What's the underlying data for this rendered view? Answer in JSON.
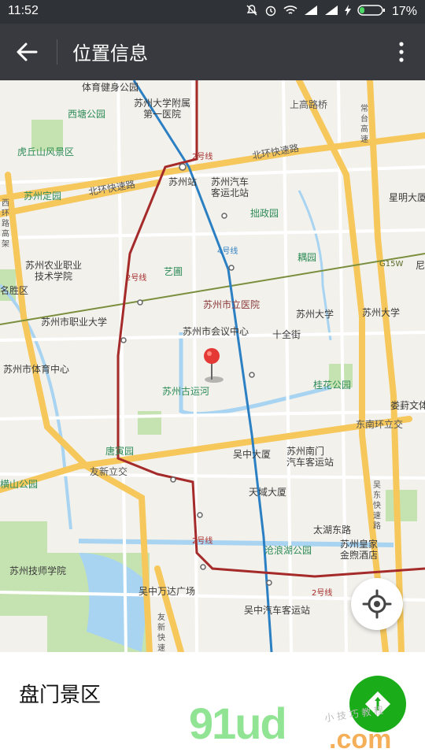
{
  "status": {
    "time": "11:52",
    "battery": "17%",
    "icons": [
      "mute-icon",
      "alarm-icon",
      "wifi-icon",
      "signal-icon",
      "signal-icon",
      "charging-icon",
      "battery-icon"
    ]
  },
  "appbar": {
    "title": "位置信息",
    "back_icon": "arrow-left-icon",
    "more_icon": "more-vertical-icon"
  },
  "map": {
    "labels": {
      "tiyu_jianshen": "体育健身公园",
      "suda_fushu": "苏州大学附属",
      "diyi_yiyuan": "第一医院",
      "xitang": "西塘公园",
      "shanggaolu": "上高路桥",
      "changtai": "常台高速",
      "huqiu": "虎丘山风景区",
      "beihuan1": "北环快速路",
      "beihuan2": "北环快速路",
      "suzhou_zhan": "苏州站",
      "qiche_keyun1": "苏州汽车",
      "qiche_keyun2": "客运北站",
      "xingming": "星明大厦",
      "dingyuan": "苏州定园",
      "xihuan": "西环路高架",
      "zhuozheng": "拙政园",
      "nongye1": "苏州农业职业",
      "nongye2": "技术学院",
      "yipu": "艺圃",
      "ouyuan": "耦园",
      "shengqu": "名胜区",
      "shili_yiyuan": "苏州市立医院",
      "zhiye": "苏州市职业大学",
      "huiyi": "苏州市会议中心",
      "suzhou_daxue1": "苏州大学",
      "suzhou_daxue2": "苏州大学",
      "shiquan": "十全街",
      "tiyu_zhongxin": "苏州市体育中心",
      "guyunhe": "苏州古运河",
      "guihua": "桂花公园",
      "loufeng": "娄葑文体",
      "dongnan": "东南环立交",
      "tangyin": "唐寅园",
      "wuzhong_dasha": "吴中大厦",
      "nanmen1": "苏州南门",
      "nanmen2": "汽车客运站",
      "youxin": "友新立交",
      "hengshan": "横山公园",
      "tianyu": "天域大厦",
      "wudong": "吴东快速路",
      "taihu": "太湖东路",
      "canglang": "沧浪湖公园",
      "huangjia1": "苏州皇家",
      "huangjia2": "金煦酒店",
      "jishi": "苏州技师学院",
      "wanda": "吴中万达广场",
      "youxin_kuai": "友新快速",
      "wuzhong_keyun": "吴中汽车客运站",
      "line2_a": "2号线",
      "line2_b": "2号线",
      "line2_c": "2号线",
      "line2_d": "2号线",
      "line4": "4号线",
      "g15w": "G15W",
      "ni": "尼"
    }
  },
  "locate_icon": "locate-icon",
  "location": {
    "name": "盘门景区",
    "nav_icon": "navigation-icon"
  },
  "watermark": {
    "main": "91ud",
    "suffix": ".com",
    "sub": "小 技 巧 教 程"
  },
  "colors": {
    "status_bar": "#2f3236",
    "app_bar": "#393a3f",
    "map_bg": "#f2f1ec",
    "expressway": "#f6c75a",
    "metro_line2": "#a52a2a",
    "metro_line4": "#2b7fc3",
    "water": "#a8d4f2",
    "park": "#c5e3b0",
    "pin": "#e53935",
    "nav_green": "#1aad19"
  }
}
